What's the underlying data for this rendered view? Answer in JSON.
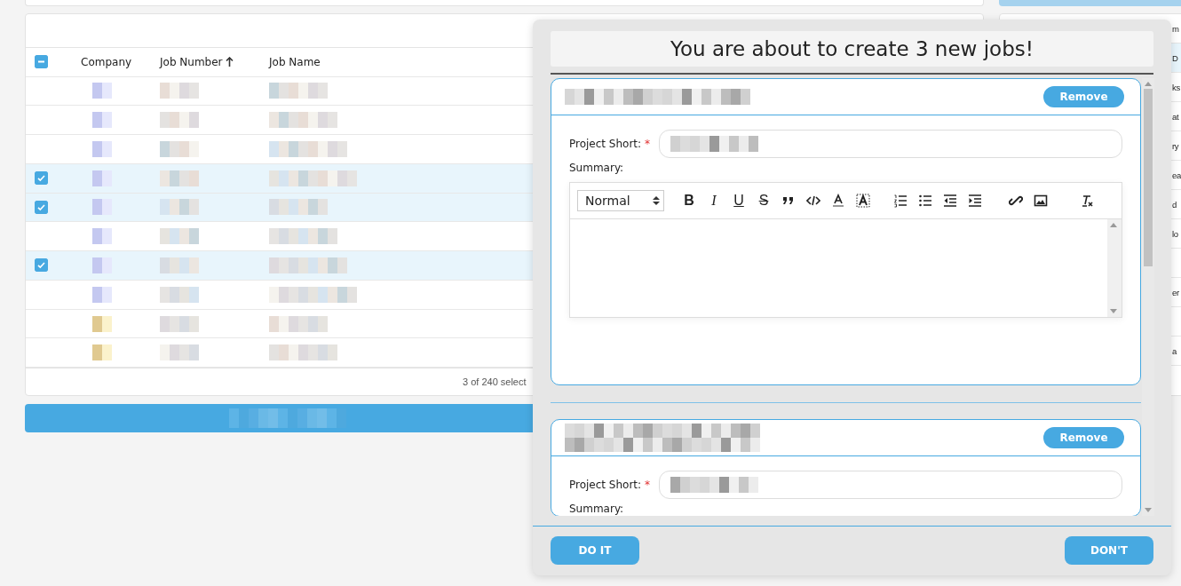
{
  "table": {
    "header_checkbox": {
      "indeterminate": true
    },
    "columns": [
      {
        "label": "Company",
        "sorted": false
      },
      {
        "label": "Job Number",
        "sorted": true
      },
      {
        "label": "Job Name",
        "sorted": false
      }
    ],
    "rows": [
      {
        "selected": false
      },
      {
        "selected": false
      },
      {
        "selected": false
      },
      {
        "selected": true
      },
      {
        "selected": true
      },
      {
        "selected": false
      },
      {
        "selected": true
      },
      {
        "selected": false
      },
      {
        "selected": false
      },
      {
        "selected": false
      }
    ],
    "footer": "3 of 240 select"
  },
  "right_panel": {
    "header": "m",
    "items": [
      {
        "text": "D",
        "selected": true
      },
      {
        "text": "ks",
        "selected": false
      },
      {
        "text": "at",
        "selected": false
      },
      {
        "text": "ry",
        "selected": false
      },
      {
        "text": "ea",
        "selected": false
      },
      {
        "text": "d",
        "selected": false
      },
      {
        "text": "lo",
        "selected": false
      },
      {
        "selected": false
      },
      {
        "text": "er",
        "selected": false
      },
      {
        "selected": false
      },
      {
        "text": "a",
        "selected": false
      }
    ]
  },
  "dialog": {
    "title": "You are about to create 3 new jobs!",
    "jobs": [
      {
        "remove": "Remove",
        "project_short_label": "Project Short:",
        "required_mark": "*",
        "summary_label": "Summary:",
        "editor": {
          "format": "Normal",
          "tools": [
            {
              "kind": "bold",
              "glyph": "B"
            },
            {
              "kind": "italic",
              "glyph": "I"
            },
            {
              "kind": "underline",
              "glyph": "U"
            },
            {
              "kind": "strike",
              "glyph": "S"
            },
            {
              "kind": "quote"
            },
            {
              "kind": "code"
            },
            {
              "kind": "color"
            },
            {
              "kind": "background"
            },
            {
              "kind": "ordered"
            },
            {
              "kind": "bullet"
            },
            {
              "kind": "outdent"
            },
            {
              "kind": "indent"
            },
            {
              "kind": "link"
            },
            {
              "kind": "image"
            },
            {
              "kind": "clean"
            }
          ]
        }
      },
      {
        "remove": "Remove",
        "project_short_label": "Project Short:",
        "required_mark": "*",
        "summary_label": "Summary:"
      }
    ],
    "buttons": [
      {
        "label": "DO IT"
      },
      {
        "label": "DON'T"
      }
    ]
  }
}
